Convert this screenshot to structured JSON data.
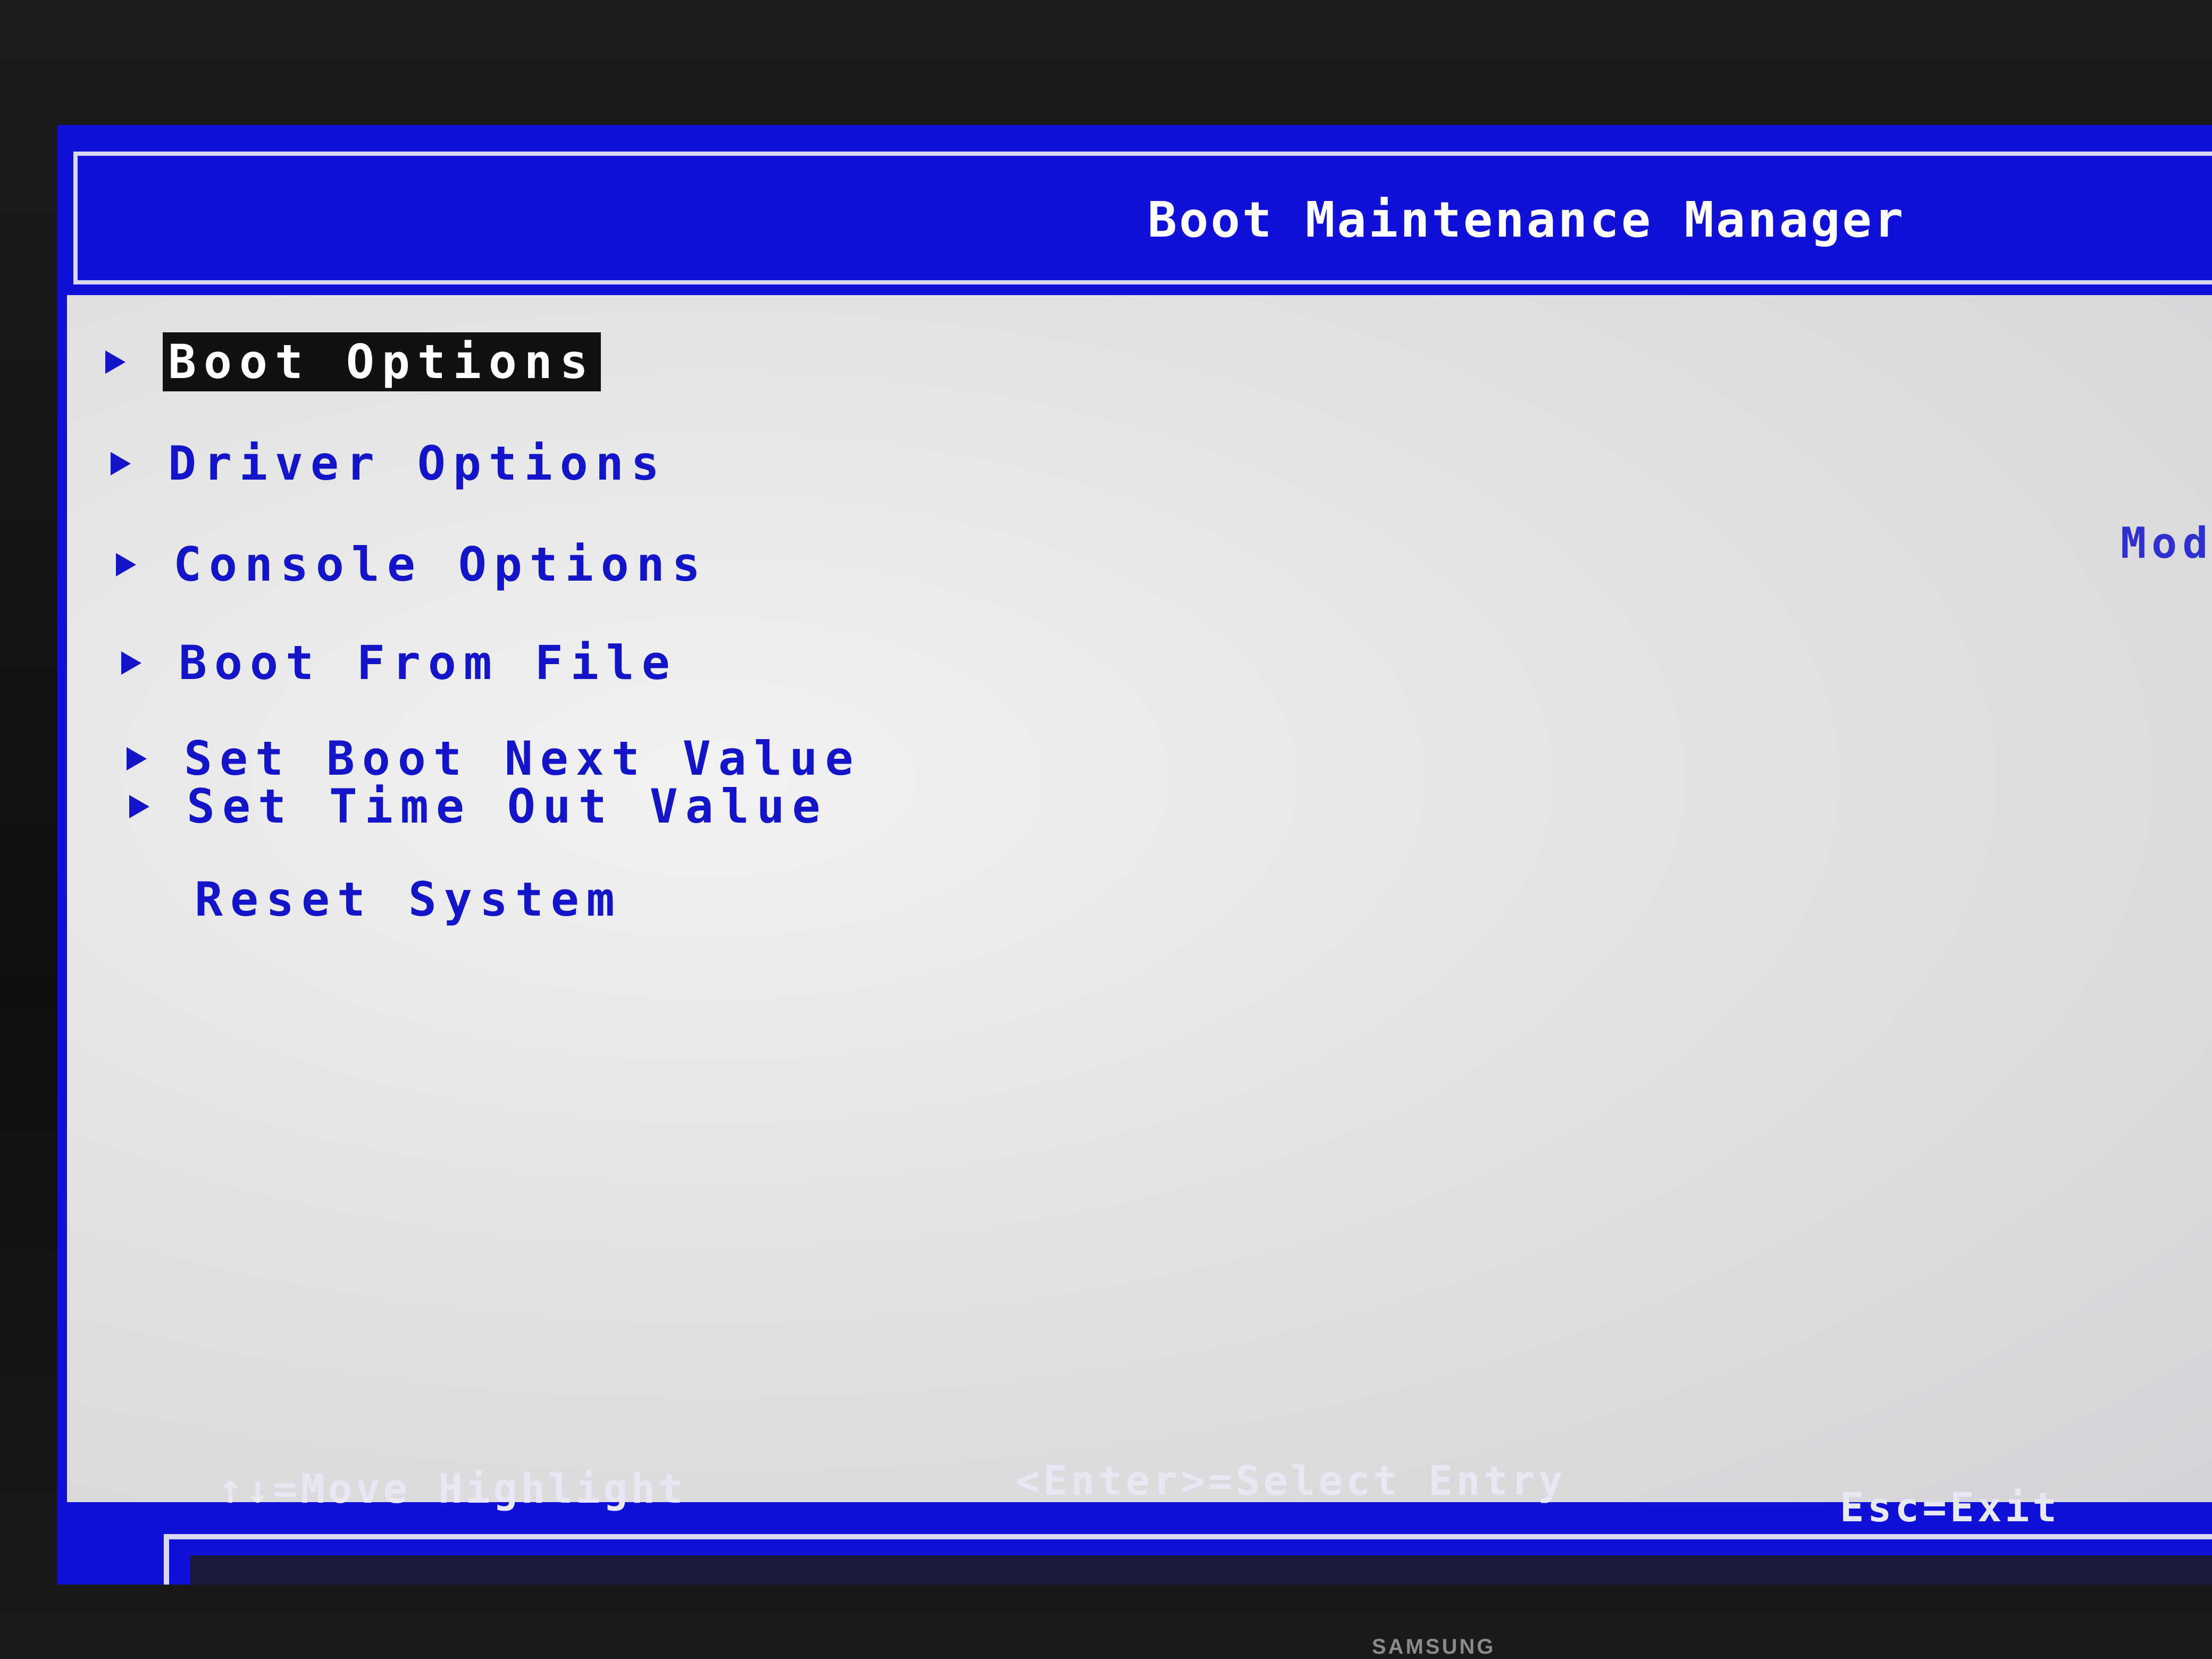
{
  "header": {
    "title": "Boot Maintenance Manager"
  },
  "menu": {
    "items": [
      {
        "label": "Boot Options",
        "has_arrow": true,
        "selected": true
      },
      {
        "label": "Driver Options",
        "has_arrow": true,
        "selected": false
      },
      {
        "label": "Console Options",
        "has_arrow": true,
        "selected": false
      },
      {
        "label": "Boot From File",
        "has_arrow": true,
        "selected": false
      },
      {
        "label": "Set Boot Next Value",
        "has_arrow": true,
        "selected": false
      },
      {
        "label": "Set Time Out Value",
        "has_arrow": true,
        "selected": false
      },
      {
        "label": "Reset System",
        "has_arrow": false,
        "selected": false
      }
    ]
  },
  "help": {
    "text": "Modif"
  },
  "footer": {
    "move": "↑↓=Move Highlight",
    "select": "<Enter>=Select Entry",
    "exit": "Esc=Exit"
  },
  "monitor": {
    "brand": "SAMSUNG"
  },
  "colors": {
    "bios_blue": "#1010d8",
    "menu_text": "#1414c8",
    "body_bg": "#e3e3e3",
    "highlight_bg": "#111111",
    "highlight_text": "#ffffff"
  },
  "icons": {
    "submenu_marker": "right-triangle-arrow"
  }
}
